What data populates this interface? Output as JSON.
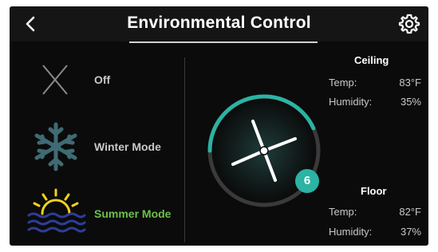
{
  "header": {
    "title": "Environmental Control",
    "back_icon": "chevron-left-icon",
    "settings_icon": "gear-icon"
  },
  "modes": [
    {
      "icon": "x-off-icon",
      "label": "Off",
      "color": "#c8c8c8"
    },
    {
      "icon": "snowflake-icon",
      "label": "Winter Mode",
      "color": "#c8c8c8"
    },
    {
      "icon": "sun-waves-icon",
      "label": "Summer Mode",
      "color": "#6cc04a"
    }
  ],
  "ceiling": {
    "title": "Ceiling",
    "temp_label": "Temp:",
    "temp_value": "83°F",
    "humidity_label": "Humidity:",
    "humidity_value": "35%"
  },
  "floor": {
    "title": "Floor",
    "temp_label": "Temp:",
    "temp_value": "82°F",
    "humidity_label": "Humidity:",
    "humidity_value": "37%"
  },
  "fan": {
    "speed": "6",
    "speed_fraction": 0.6,
    "icon": "fan-blades-icon"
  },
  "colors": {
    "accent": "#2bb3a3",
    "summer": "#6cc04a",
    "sun": "#f2d11f",
    "water": "#2c3e9a",
    "snow": "#3f6b73"
  }
}
